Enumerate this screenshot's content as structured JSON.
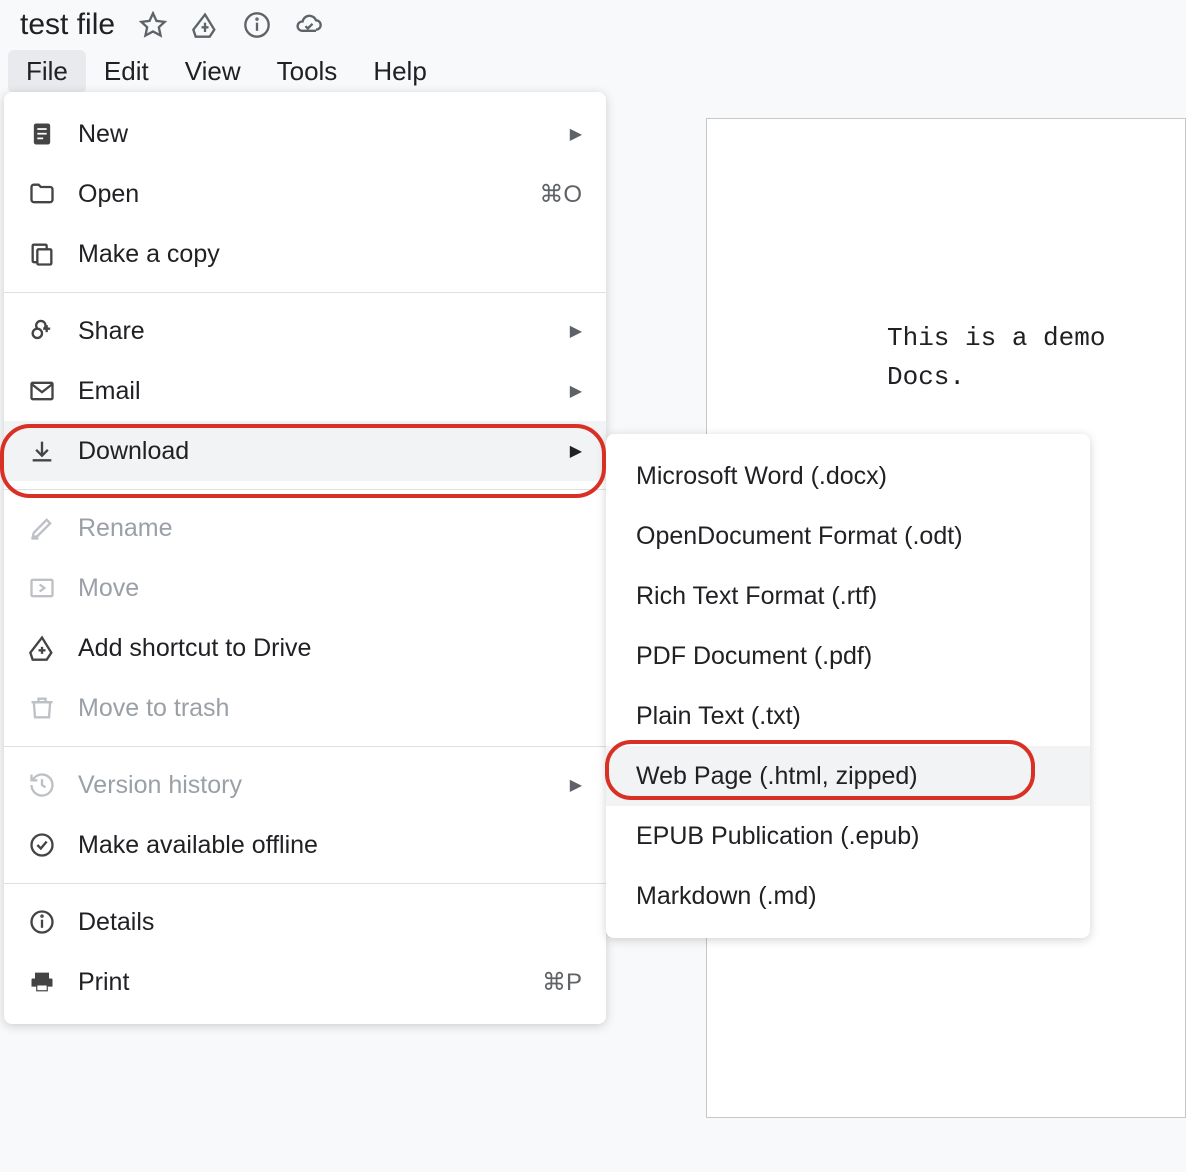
{
  "doc": {
    "title": "test file",
    "content_line1": "This is a demo",
    "content_line2": "Docs."
  },
  "menubar": {
    "file": "File",
    "edit": "Edit",
    "view": "View",
    "tools": "Tools",
    "help": "Help"
  },
  "file_menu": {
    "new": "New",
    "open": "Open",
    "open_shortcut": "⌘O",
    "make_copy": "Make a copy",
    "share": "Share",
    "email": "Email",
    "download": "Download",
    "rename": "Rename",
    "move": "Move",
    "add_shortcut": "Add shortcut to Drive",
    "move_trash": "Move to trash",
    "version_history": "Version history",
    "make_offline": "Make available offline",
    "details": "Details",
    "print": "Print",
    "print_shortcut": "⌘P"
  },
  "download_submenu": {
    "docx": "Microsoft Word (.docx)",
    "odt": "OpenDocument Format (.odt)",
    "rtf": "Rich Text Format (.rtf)",
    "pdf": "PDF Document (.pdf)",
    "txt": "Plain Text (.txt)",
    "html": "Web Page (.html, zipped)",
    "epub": "EPUB Publication (.epub)",
    "md": "Markdown (.md)"
  }
}
